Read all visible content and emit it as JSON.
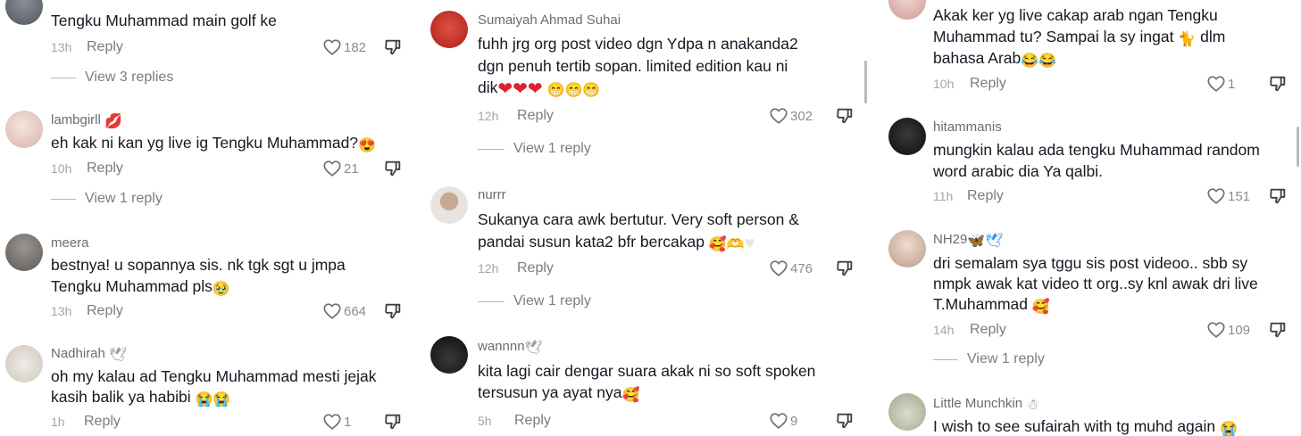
{
  "actions": {
    "reply_label": "Reply"
  },
  "col1": {
    "c1": {
      "text": "Tengku Muhammad main golf ke",
      "time": "13h",
      "likes": "182",
      "view_replies": "View 3 replies"
    },
    "c2": {
      "username": "lambgirll",
      "emoji": "💋",
      "text": "eh kak ni kan yg live ig Tengku Muhammad?",
      "text_emoji": "😍",
      "time": "10h",
      "likes": "21",
      "view_replies": "View 1 reply"
    },
    "c3": {
      "username": "meera",
      "line1": "bestnya! u sopannya sis. nk tgk sgt u jmpa",
      "line2": "Tengku Muhammad pls",
      "line2_emoji": "🥹",
      "time": "13h",
      "likes": "664"
    },
    "c4": {
      "username": "Nadhirah",
      "emoji": "🕊",
      "line1": "oh my kalau ad Tengku Muhammad mesti jejak",
      "line2": "kasih balik ya habibi",
      "line2_emoji": "😭😭",
      "time": "1h",
      "likes": "1"
    }
  },
  "col2": {
    "c1": {
      "username": "Sumaiyah Ahmad Suhai",
      "line1": "fuhh jrg org post video dgn Ydpa n anakanda2",
      "line2": "dgn penuh tertib sopan. limited edition kau ni",
      "line3": "dik",
      "hearts": "❤❤❤",
      "line3_emoji": "😁😁😁",
      "time": "12h",
      "likes": "302",
      "view_replies": "View 1 reply"
    },
    "c2": {
      "username": "nurrr",
      "line1": "Sukanya cara awk bertutur. Very soft person &",
      "line2": "pandai susun kata2 bfr bercakap",
      "line2_emoji": "🥰🫶",
      "white_heart": "♥",
      "time": "12h",
      "likes": "476",
      "view_replies": "View 1 reply"
    },
    "c3": {
      "username": "wannnn",
      "emoji": "🕊",
      "line1": "kita lagi cair dengar suara akak ni so soft spoken",
      "line2": "tersusun ya ayat nya",
      "line2_emoji": "🥰",
      "time": "5h",
      "likes": "9"
    }
  },
  "col3": {
    "c1": {
      "line1": "Akak ker yg live cakap arab ngan Tengku",
      "line2": "Muhammad tu? Sampai la sy ingat",
      "line2_emoji": "🐈",
      "line2_tail": "dlm",
      "line3": "bahasa Arab",
      "line3_emoji": "😂😂",
      "time": "10h",
      "likes": "1"
    },
    "c2": {
      "username": "hitammanis",
      "line1": "mungkin kalau ada tengku Muhammad random",
      "line2": "word arabic dia Ya qalbi.",
      "time": "11h",
      "likes": "151"
    },
    "c3": {
      "username": "NH29",
      "emoji": "🦋🕊",
      "line1": "dri semalam sya tggu sis post videoo.. sbb sy",
      "line2": "nmpk awak kat video tt org..sy knl awak dri live",
      "line3": "T.Muhammad",
      "line3_emoji": "🥰",
      "time": "14h",
      "likes": "109",
      "view_replies": "View 1 reply"
    },
    "c4": {
      "username": "Little Munchkin",
      "emoji": "☃",
      "line1": "I wish to see sufairah with tg muhd again",
      "line1_emoji": "😭"
    }
  },
  "colors": {
    "text": "#161823",
    "muted": "#7b7c82",
    "time": "#a3a4a8",
    "heart_emoji": "#e0202e"
  },
  "icons": {
    "like": "heart-outline-icon",
    "dislike": "thumbs-down-outline-icon"
  }
}
